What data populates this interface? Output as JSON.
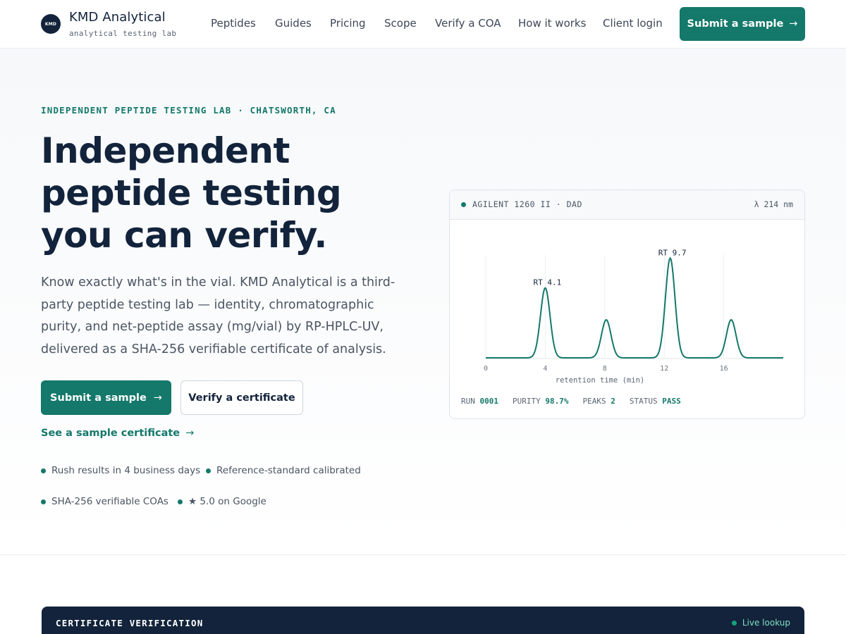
{
  "header": {
    "logo_text": "KMD",
    "brand_name": "KMD Analytical",
    "brand_tag": "analytical testing lab",
    "nav": [
      "Peptides",
      "Guides",
      "Pricing",
      "Scope",
      "Verify a COA",
      "How it works",
      "Client login"
    ],
    "cta": "Submit a sample"
  },
  "hero": {
    "eyebrow": "INDEPENDENT PEPTIDE TESTING LAB · CHATSWORTH, CA",
    "headline": "Independent peptide testing you can verify.",
    "lede": "Know exactly what's in the vial. KMD Analytical is a third-party peptide testing lab — identity, chromatographic purity, and net-peptide assay (mg/vial) by RP-HPLC-UV, delivered as a SHA-256 verifiable certificate of analysis.",
    "primary_btn": "Submit a sample",
    "secondary_btn": "Verify a certificate",
    "sample_link": "See a sample certificate",
    "arrow": "→",
    "features": [
      "Rush results in 4 business days",
      "Reference-standard calibrated",
      "SHA-256 verifiable COAs",
      "★ 5.0 on Google"
    ]
  },
  "card": {
    "instrument": "AGILENT 1260 II · DAD",
    "wavelength": "λ 214 nm",
    "stats": {
      "run_label": "RUN",
      "run": "0001",
      "purity_label": "PURITY",
      "purity": "98.7%",
      "peaks_label": "PEAKS",
      "peaks": "2",
      "status_label": "STATUS",
      "status": "PASS"
    }
  },
  "chart_data": {
    "type": "line",
    "xlabel": "retention time (min)",
    "ylabel": "",
    "xlim": [
      0,
      20
    ],
    "x_ticks": [
      0,
      4,
      8,
      12,
      16
    ],
    "peaks": [
      {
        "rt": 4.0,
        "height": 0.68,
        "label": "RT 4.1"
      },
      {
        "rt": 8.1,
        "height": 0.37,
        "label": ""
      },
      {
        "rt": 12.4,
        "height": 0.97,
        "label": "RT 9.7"
      },
      {
        "rt": 16.5,
        "height": 0.37,
        "label": ""
      }
    ],
    "grid": true,
    "color": "#14786a"
  },
  "verify": {
    "title": "CERTIFICATE VERIFICATION",
    "live": "Live lookup"
  }
}
